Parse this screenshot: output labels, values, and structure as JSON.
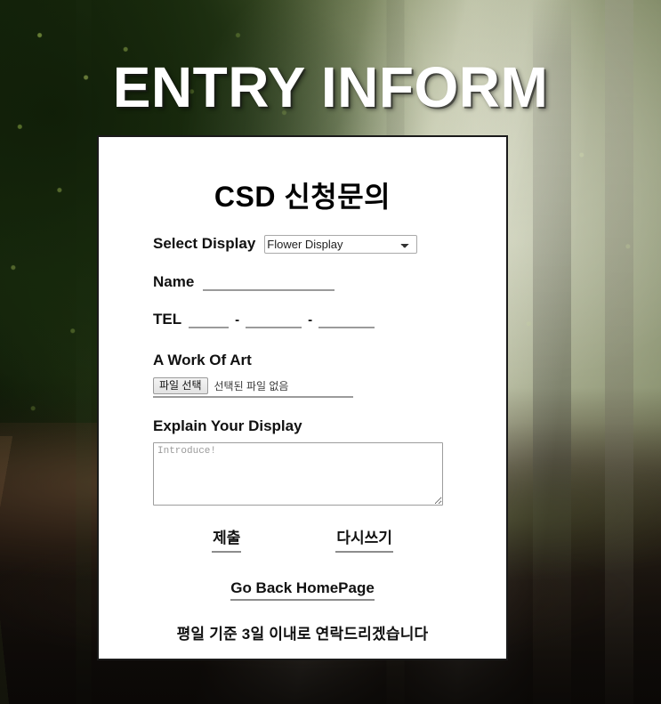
{
  "page": {
    "title": "ENTRY INFORM",
    "background_description": "misty-forest-photo"
  },
  "colors": {
    "card_background": "#ffffff",
    "card_border": "#1a1a1a",
    "title_text": "#ffffff",
    "body_text": "#111111",
    "underline": "#9b9b9b",
    "placeholder_text": "#9a9a9a"
  },
  "form": {
    "heading": "CSD 신청문의",
    "select_display": {
      "label": "Select Display",
      "selected": "Flower Display",
      "options": [
        "Flower Display"
      ],
      "chevron_icon": "chevron-down-icon"
    },
    "name": {
      "label": "Name",
      "value": "",
      "placeholder": ""
    },
    "tel": {
      "label": "TEL",
      "separator": "-",
      "part1": "",
      "part2": "",
      "part3": ""
    },
    "artwork": {
      "heading": "A Work Of Art",
      "button_label": "파일 선택",
      "status_text": "선택된 파일 없음"
    },
    "explain": {
      "heading": "Explain Your Display",
      "value": "",
      "placeholder": "Introduce!"
    },
    "actions": {
      "submit_label": "제출",
      "reset_label": "다시쓰기"
    },
    "home_link": "Go Back HomePage",
    "notice": "평일 기준 3일 이내로 연락드리겠습니다"
  }
}
